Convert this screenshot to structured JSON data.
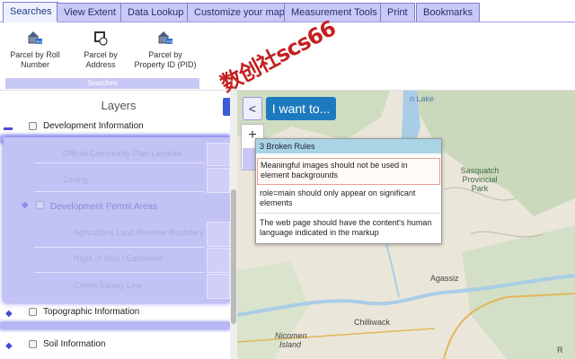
{
  "tabs": [
    {
      "label": "Searches"
    },
    {
      "label": "View Extent"
    },
    {
      "label": "Data Lookup"
    },
    {
      "label": "Customize your map"
    },
    {
      "label": "Measurement Tools"
    },
    {
      "label": "Print"
    },
    {
      "label": "Bookmarks"
    }
  ],
  "ribbon": {
    "buttons": [
      {
        "label": "Parcel by Roll Number"
      },
      {
        "label": "Parcel by Address"
      },
      {
        "label": "Parcel by Property ID (PID)"
      }
    ],
    "group_label": "Searches"
  },
  "layers": {
    "title": "Layers",
    "items": [
      {
        "label": "Development Information"
      },
      {
        "label": "Official Community Plan Landuse"
      },
      {
        "label": "Zoning"
      },
      {
        "label": "Development Permit Areas"
      },
      {
        "label": "Agricultural Land Reserve Boundary"
      },
      {
        "label": "Right of Way / Easement"
      },
      {
        "label": "Crown Survey Line"
      },
      {
        "label": "Topographic Information"
      },
      {
        "label": "Soil Information"
      }
    ]
  },
  "map": {
    "collapse_label": "<",
    "iwant_label": "I want to...",
    "zoom_in": "+",
    "popup": {
      "header": "3 Broken Rules",
      "rules": [
        {
          "text": "Meaningful images should not be used in element backgrounds"
        },
        {
          "text": "role=main should only appear on significant elements"
        },
        {
          "text": "The web page should have the content's human language indicated in the markup"
        }
      ]
    },
    "labels": {
      "lake": "n Lake",
      "sasquatch": "Sasquatch Provincial Park",
      "agassiz": "Agassiz",
      "chilliwack": "Chilliwack",
      "nicomen": "Nicomen Island",
      "corner": "R"
    }
  },
  "watermark": "数创社scs66",
  "colors": {
    "tab_bg": "#c9c9f7",
    "tab_active_bg": "#eef0ff",
    "highlight": "#b7b7f3",
    "iwant_bg": "#1e7abf",
    "popup_header": "#a9d4e6",
    "watermark": "#c42020"
  }
}
